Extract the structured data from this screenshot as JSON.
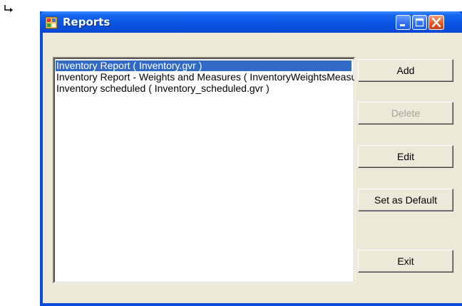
{
  "window": {
    "title": "Reports",
    "buttons": {
      "minimize_icon": "minimize-icon",
      "maximize_icon": "maximize-icon",
      "close_icon": "close-icon"
    }
  },
  "reports_list": {
    "items": [
      {
        "label": "Inventory Report    ( Inventory.gvr )",
        "selected": true
      },
      {
        "label": "Inventory Report -  Weights and Measures    ( InventoryWeightsMeasures.gvr )",
        "selected": false
      },
      {
        "label": "Inventory scheduled    ( Inventory_scheduled.gvr )",
        "selected": false
      }
    ]
  },
  "actions": {
    "add": "Add",
    "delete": "Delete",
    "edit": "Edit",
    "set_default": "Set as Default",
    "exit": "Exit"
  },
  "colors": {
    "titlebar": "#0a55e4",
    "client": "#ece9d8",
    "selection": "#316ac5"
  }
}
